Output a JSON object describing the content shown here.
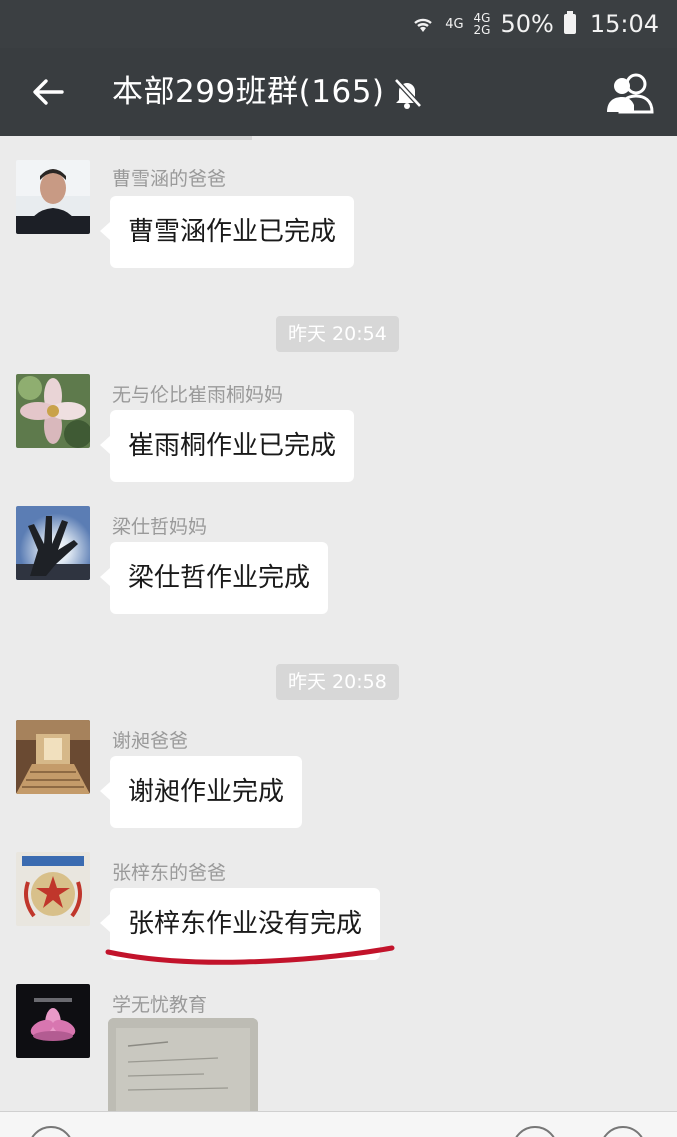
{
  "status_bar": {
    "signal_label_1": "4G",
    "signal_label_2a": "4G",
    "signal_label_2b": "2G",
    "battery": "50%",
    "time": "15:04",
    "icons": [
      "wifi-icon",
      "signal-icon",
      "battery-icon"
    ]
  },
  "nav": {
    "title": "本部299班群(165)",
    "icons": [
      "back-arrow-icon",
      "mute-bell-icon",
      "group-members-icon"
    ]
  },
  "messages": [
    {
      "type": "text",
      "sender": "曹雪涵的爸爸",
      "text": "曹雪涵作业已完成",
      "avatar": "man-portrait-avatar"
    },
    {
      "type": "time",
      "text": "昨天 20:54"
    },
    {
      "type": "text",
      "sender": "无与伦比崔雨桐妈妈",
      "text": "崔雨桐作业已完成",
      "avatar": "flower-avatar"
    },
    {
      "type": "text",
      "sender": "梁仕哲妈妈",
      "text": "梁仕哲作业完成",
      "avatar": "hand-sunlight-avatar"
    },
    {
      "type": "time",
      "text": "昨天 20:58"
    },
    {
      "type": "text",
      "sender": "谢昶爸爸",
      "text": "谢昶作业完成",
      "avatar": "hallway-avatar"
    },
    {
      "type": "text",
      "sender": "张梓东的爸爸",
      "text": "张梓东作业没有完成",
      "avatar": "emblem-avatar",
      "highlighted": true
    },
    {
      "type": "image",
      "sender": "学无忧教育",
      "avatar": "lotus-avatar"
    }
  ],
  "colors": {
    "header_bg": "#393d40",
    "chat_bg": "#ebebeb",
    "bubble_bg": "#ffffff",
    "underline": "#c2132b"
  }
}
